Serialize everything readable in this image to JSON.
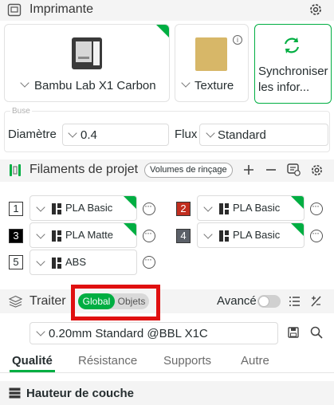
{
  "printer": {
    "title": "Imprimante",
    "printer_name": "Bambu Lab X1 Carbon",
    "plate_name": "Texture",
    "sync_label": "Synchroniser les infor..."
  },
  "nozzle": {
    "group_label": "Buse",
    "diameter_label": "Diamètre",
    "diameter_value": "0.4",
    "flow_label": "Flux",
    "flow_value": "Standard"
  },
  "filaments": {
    "title": "Filaments de projet",
    "flush_button": "Volumes de rinçage",
    "slots": [
      {
        "number": "1",
        "name": "PLA Basic",
        "number_bg": "#ffffff",
        "number_fg": "#262e30"
      },
      {
        "number": "2",
        "name": "PLA Basic",
        "number_bg": "#c12e1f",
        "number_fg": "#ffffff"
      },
      {
        "number": "3",
        "name": "PLA Matte",
        "number_bg": "#000000",
        "number_fg": "#ffffff"
      },
      {
        "number": "4",
        "name": "PLA Basic",
        "number_bg": "#5b6068",
        "number_fg": "#ffffff"
      },
      {
        "number": "5",
        "name": "ABS",
        "number_bg": "#ffffff",
        "number_fg": "#262e30"
      }
    ]
  },
  "process": {
    "title": "Traiter",
    "toggle_global": "Global",
    "toggle_objects": "Objets",
    "advanced_label": "Avancé",
    "preset_value": "0.20mm Standard @BBL X1C",
    "tabs": [
      "Qualité",
      "Résistance",
      "Supports",
      "Autre"
    ],
    "active_tab": "Qualité",
    "group_title": "Hauteur de couche"
  },
  "colors": {
    "accent": "#00ae42",
    "highlight_box": "#e01010",
    "section_bg": "#f4f4f4"
  }
}
